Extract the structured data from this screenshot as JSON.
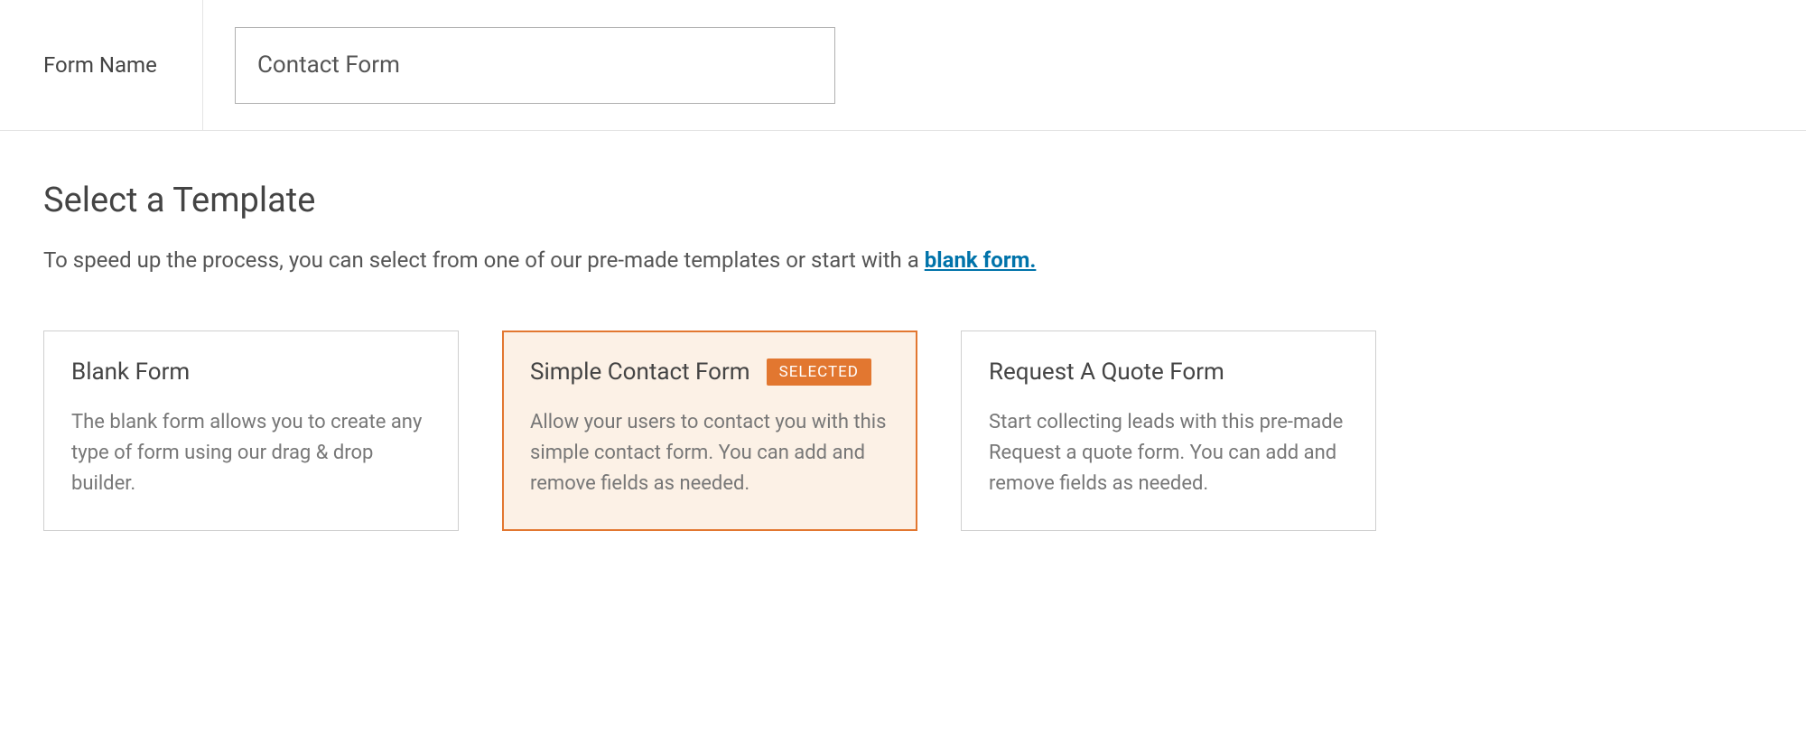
{
  "header": {
    "form_name_label": "Form Name",
    "form_name_value": "Contact Form"
  },
  "section": {
    "heading": "Select a Template",
    "subtext_prefix": "To speed up the process, you can select from one of our pre-made templates or start with a ",
    "blank_link_text": "blank form."
  },
  "templates": [
    {
      "title": "Blank Form",
      "description": "The blank form allows you to create any type of form using our drag & drop builder.",
      "selected": false
    },
    {
      "title": "Simple Contact Form",
      "description": "Allow your users to contact you with this simple contact form. You can add and remove fields as needed.",
      "selected": true,
      "badge": "SELECTED"
    },
    {
      "title": "Request A Quote Form",
      "description": "Start collecting leads with this pre-made Request a quote form. You can add and remove fields as needed.",
      "selected": false
    }
  ]
}
